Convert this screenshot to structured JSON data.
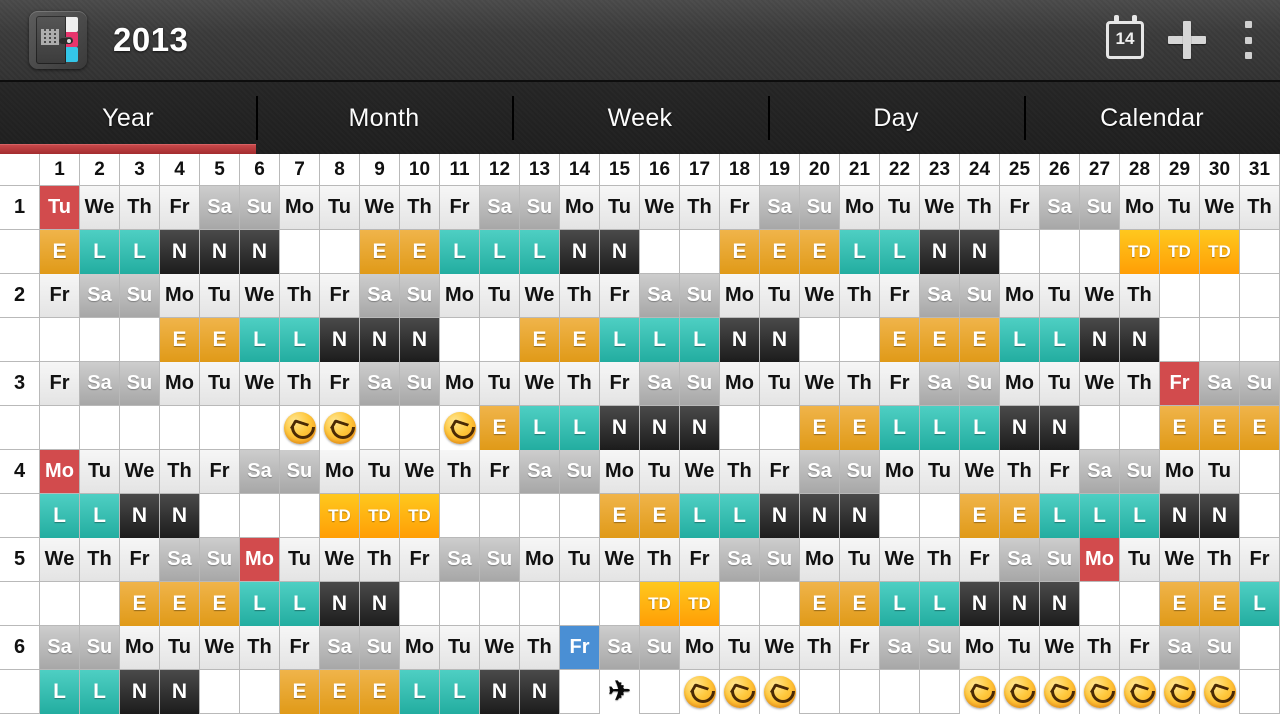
{
  "action_bar": {
    "title": "2013",
    "app_icon": "calendar-book-icon",
    "actions": [
      {
        "name": "today-calendar-icon",
        "day_number": "14"
      },
      {
        "name": "add-icon",
        "label": "+"
      },
      {
        "name": "overflow-menu-icon",
        "label": "⋮"
      }
    ]
  },
  "tabs": [
    {
      "label": "Year",
      "active": true
    },
    {
      "label": "Month",
      "active": false
    },
    {
      "label": "Week",
      "active": false
    },
    {
      "label": "Day",
      "active": false
    },
    {
      "label": "Calendar",
      "active": false
    }
  ],
  "grid": {
    "corner": "",
    "day_numbers": [
      "1",
      "2",
      "3",
      "4",
      "5",
      "6",
      "7",
      "8",
      "9",
      "10",
      "11",
      "12",
      "13",
      "14",
      "15",
      "16",
      "17",
      "18",
      "19",
      "20",
      "21",
      "22",
      "23",
      "24",
      "25",
      "26",
      "27",
      "28",
      "29",
      "30",
      "31"
    ],
    "shift_legend": {
      "E": "Early shift",
      "L": "Late shift",
      "N": "Night shift",
      "TD": "Training day",
      "smiley": "happy-face-event",
      "plane": "travel-event"
    },
    "colors": {
      "holiday": "#d24b4d",
      "today": "#4a8fd4",
      "weekend": "#b4b4b4",
      "weekday": "#ededed",
      "early": "#e09a18",
      "late": "#23ada0",
      "night": "#1c1c1c",
      "training": "#ff9e05",
      "accent": "#a32c2e"
    },
    "months": [
      {
        "number": "1",
        "weekdays": [
          "Tu",
          "We",
          "Th",
          "Fr",
          "Sa",
          "Su",
          "Mo",
          "Tu",
          "We",
          "Th",
          "Fr",
          "Sa",
          "Su",
          "Mo",
          "Tu",
          "We",
          "Th",
          "Fr",
          "Sa",
          "Su",
          "Mo",
          "Tu",
          "We",
          "Th",
          "Fr",
          "Sa",
          "Su",
          "Mo",
          "Tu",
          "We",
          "Th"
        ],
        "kinds": [
          "hol",
          "wk",
          "wk",
          "wk",
          "we",
          "we",
          "wk",
          "wk",
          "wk",
          "wk",
          "wk",
          "we",
          "we",
          "wk",
          "wk",
          "wk",
          "wk",
          "wk",
          "we",
          "we",
          "wk",
          "wk",
          "wk",
          "wk",
          "wk",
          "we",
          "we",
          "wk",
          "wk",
          "wk",
          "wk"
        ],
        "shifts": [
          "E",
          "L",
          "L",
          "N",
          "N",
          "N",
          "",
          "",
          "E",
          "E",
          "L",
          "L",
          "L",
          "N",
          "N",
          "",
          "",
          "E",
          "E",
          "E",
          "L",
          "L",
          "N",
          "N",
          "",
          "",
          "",
          "TD",
          "TD",
          "TD",
          ""
        ]
      },
      {
        "number": "2",
        "weekdays": [
          "Fr",
          "Sa",
          "Su",
          "Mo",
          "Tu",
          "We",
          "Th",
          "Fr",
          "Sa",
          "Su",
          "Mo",
          "Tu",
          "We",
          "Th",
          "Fr",
          "Sa",
          "Su",
          "Mo",
          "Tu",
          "We",
          "Th",
          "Fr",
          "Sa",
          "Su",
          "Mo",
          "Tu",
          "We",
          "Th",
          "",
          "",
          ""
        ],
        "kinds": [
          "wk",
          "we",
          "we",
          "wk",
          "wk",
          "wk",
          "wk",
          "wk",
          "we",
          "we",
          "wk",
          "wk",
          "wk",
          "wk",
          "wk",
          "we",
          "we",
          "wk",
          "wk",
          "wk",
          "wk",
          "wk",
          "we",
          "we",
          "wk",
          "wk",
          "wk",
          "wk",
          "none",
          "none",
          "none"
        ],
        "shifts": [
          "",
          "",
          "",
          "E",
          "E",
          "L",
          "L",
          "N",
          "N",
          "N",
          "",
          "",
          "E",
          "E",
          "L",
          "L",
          "L",
          "N",
          "N",
          "",
          "",
          "E",
          "E",
          "E",
          "L",
          "L",
          "N",
          "N",
          "",
          "",
          ""
        ]
      },
      {
        "number": "3",
        "weekdays": [
          "Fr",
          "Sa",
          "Su",
          "Mo",
          "Tu",
          "We",
          "Th",
          "Fr",
          "Sa",
          "Su",
          "Mo",
          "Tu",
          "We",
          "Th",
          "Fr",
          "Sa",
          "Su",
          "Mo",
          "Tu",
          "We",
          "Th",
          "Fr",
          "Sa",
          "Su",
          "Mo",
          "Tu",
          "We",
          "Th",
          "Fr",
          "Sa",
          "Su"
        ],
        "kinds": [
          "wk",
          "we",
          "we",
          "wk",
          "wk",
          "wk",
          "wk",
          "wk",
          "we",
          "we",
          "wk",
          "wk",
          "wk",
          "wk",
          "wk",
          "we",
          "we",
          "wk",
          "wk",
          "wk",
          "wk",
          "wk",
          "we",
          "we",
          "wk",
          "wk",
          "wk",
          "wk",
          "hol",
          "we",
          "we"
        ],
        "shifts": [
          "",
          "",
          "",
          "",
          "",
          "",
          "smiley",
          "smiley",
          "",
          "",
          "smiley",
          "E",
          "L",
          "L",
          "N",
          "N",
          "N",
          "",
          "",
          "E",
          "E",
          "L",
          "L",
          "L",
          "N",
          "N",
          "",
          "",
          "E",
          "E",
          "E"
        ]
      },
      {
        "number": "4",
        "weekdays": [
          "Mo",
          "Tu",
          "We",
          "Th",
          "Fr",
          "Sa",
          "Su",
          "Mo",
          "Tu",
          "We",
          "Th",
          "Fr",
          "Sa",
          "Su",
          "Mo",
          "Tu",
          "We",
          "Th",
          "Fr",
          "Sa",
          "Su",
          "Mo",
          "Tu",
          "We",
          "Th",
          "Fr",
          "Sa",
          "Su",
          "Mo",
          "Tu",
          ""
        ],
        "kinds": [
          "hol",
          "wk",
          "wk",
          "wk",
          "wk",
          "we",
          "we",
          "wk",
          "wk",
          "wk",
          "wk",
          "wk",
          "we",
          "we",
          "wk",
          "wk",
          "wk",
          "wk",
          "wk",
          "we",
          "we",
          "wk",
          "wk",
          "wk",
          "wk",
          "wk",
          "we",
          "we",
          "wk",
          "wk",
          "none"
        ],
        "shifts": [
          "L",
          "L",
          "N",
          "N",
          "",
          "",
          "",
          "TD",
          "TD",
          "TD",
          "",
          "",
          "",
          "",
          "E",
          "E",
          "L",
          "L",
          "N",
          "N",
          "N",
          "",
          "",
          "E",
          "E",
          "L",
          "L",
          "L",
          "N",
          "N",
          ""
        ]
      },
      {
        "number": "5",
        "weekdays": [
          "We",
          "Th",
          "Fr",
          "Sa",
          "Su",
          "Mo",
          "Tu",
          "We",
          "Th",
          "Fr",
          "Sa",
          "Su",
          "Mo",
          "Tu",
          "We",
          "Th",
          "Fr",
          "Sa",
          "Su",
          "Mo",
          "Tu",
          "We",
          "Th",
          "Fr",
          "Sa",
          "Su",
          "Mo",
          "Tu",
          "We",
          "Th",
          "Fr"
        ],
        "kinds": [
          "wk",
          "wk",
          "wk",
          "we",
          "we",
          "hol",
          "wk",
          "wk",
          "wk",
          "wk",
          "we",
          "we",
          "wk",
          "wk",
          "wk",
          "wk",
          "wk",
          "we",
          "we",
          "wk",
          "wk",
          "wk",
          "wk",
          "wk",
          "we",
          "we",
          "hol",
          "wk",
          "wk",
          "wk",
          "wk"
        ],
        "shifts": [
          "",
          "",
          "E",
          "E",
          "E",
          "L",
          "L",
          "N",
          "N",
          "",
          "",
          "",
          "",
          "",
          "",
          "TD",
          "TD",
          "",
          "",
          "E",
          "E",
          "L",
          "L",
          "N",
          "N",
          "N",
          "",
          "",
          "E",
          "E",
          "L"
        ]
      },
      {
        "number": "6",
        "weekdays": [
          "Sa",
          "Su",
          "Mo",
          "Tu",
          "We",
          "Th",
          "Fr",
          "Sa",
          "Su",
          "Mo",
          "Tu",
          "We",
          "Th",
          "Fr",
          "Sa",
          "Su",
          "Mo",
          "Tu",
          "We",
          "Th",
          "Fr",
          "Sa",
          "Su",
          "Mo",
          "Tu",
          "We",
          "Th",
          "Fr",
          "Sa",
          "Su",
          ""
        ],
        "kinds": [
          "we",
          "we",
          "wk",
          "wk",
          "wk",
          "wk",
          "wk",
          "we",
          "we",
          "wk",
          "wk",
          "wk",
          "wk",
          "today",
          "we",
          "we",
          "wk",
          "wk",
          "wk",
          "wk",
          "wk",
          "we",
          "we",
          "wk",
          "wk",
          "wk",
          "wk",
          "wk",
          "we",
          "we",
          "none"
        ],
        "shifts": [
          "L",
          "L",
          "N",
          "N",
          "",
          "",
          "E",
          "E",
          "E",
          "L",
          "L",
          "N",
          "N",
          "",
          "plane",
          "",
          "smiley",
          "smiley",
          "smiley",
          "",
          "",
          "",
          "",
          "smiley",
          "smiley",
          "smiley",
          "smiley",
          "smiley",
          "smiley",
          "smiley",
          ""
        ]
      }
    ]
  }
}
